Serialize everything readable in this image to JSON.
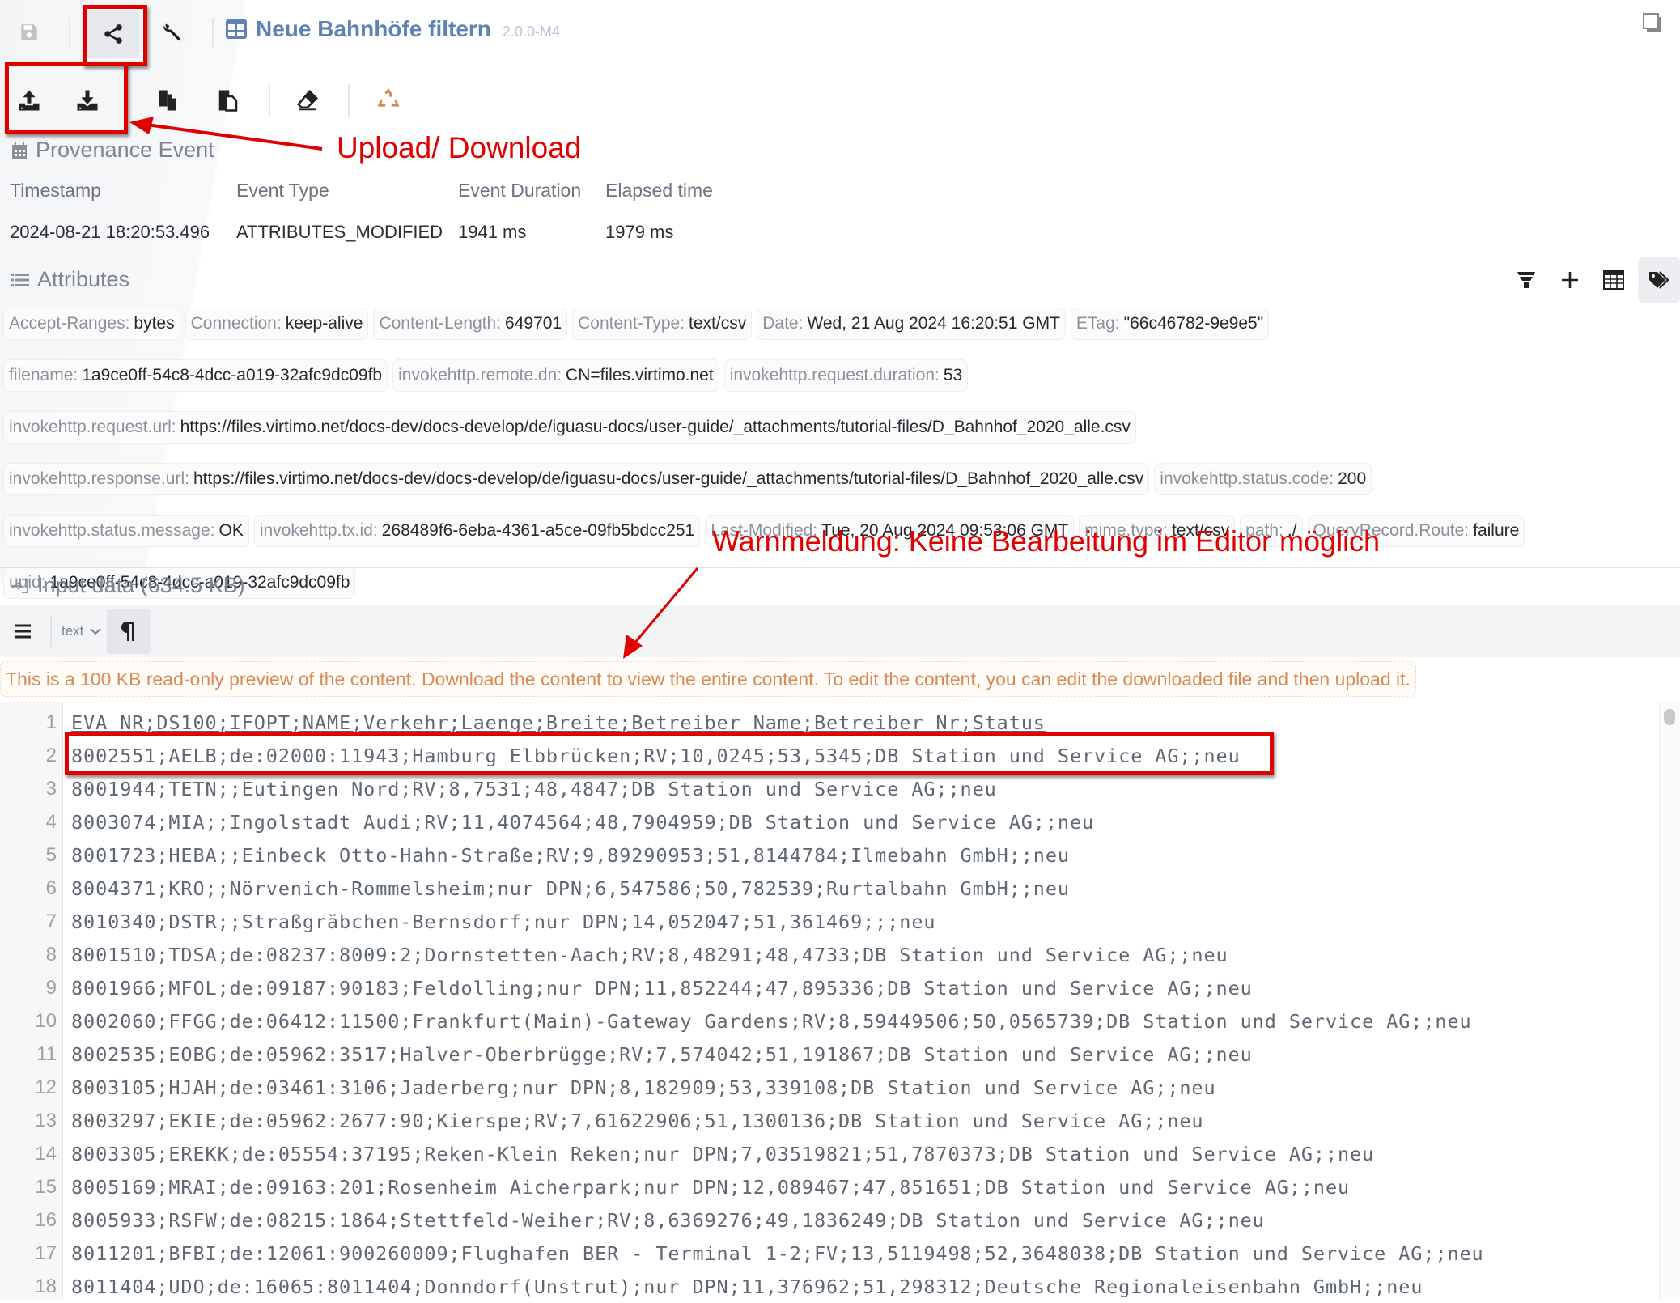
{
  "header": {
    "title": "Neue Bahnhöfe filtern",
    "version": "2.0.0-M4",
    "icons": [
      "save-icon",
      "share-icon",
      "wrench-icon",
      "table-icon",
      "window-icon"
    ]
  },
  "toolbar2": {
    "icons": [
      "upload-icon",
      "download-icon",
      "copy-icon",
      "paste-icon",
      "eraser-icon",
      "recycle-icon"
    ]
  },
  "provenance": {
    "heading": "Provenance Event",
    "columns": [
      {
        "label": "Timestamp",
        "value": "2024-08-21 18:20:53.496"
      },
      {
        "label": "Event Type",
        "value": "ATTRIBUTES_MODIFIED"
      },
      {
        "label": "Event Duration",
        "value": "1941 ms"
      },
      {
        "label": "Elapsed time",
        "value": "1979 ms"
      }
    ]
  },
  "attributes": {
    "heading": "Attributes",
    "actions": [
      "filter-icon",
      "add-icon",
      "table-view-icon",
      "tags-icon"
    ],
    "items": [
      {
        "key": "Accept-Ranges:",
        "value": "bytes"
      },
      {
        "key": "Connection:",
        "value": "keep-alive"
      },
      {
        "key": "Content-Length:",
        "value": "649701"
      },
      {
        "key": "Content-Type:",
        "value": "text/csv"
      },
      {
        "key": "Date:",
        "value": "Wed, 21 Aug 2024 16:20:51 GMT"
      },
      {
        "key": "ETag:",
        "value": "\"66c46782-9e9e5\""
      },
      {
        "key": "filename:",
        "value": "1a9ce0ff-54c8-4dcc-a019-32afc9dc09fb"
      },
      {
        "key": "invokehttp.remote.dn:",
        "value": "CN=files.virtimo.net"
      },
      {
        "key": "invokehttp.request.duration:",
        "value": "53"
      },
      {
        "key": "invokehttp.request.url:",
        "value": "https://files.virtimo.net/docs-dev/docs-develop/de/iguasu-docs/user-guide/_attachments/tutorial-files/D_Bahnhof_2020_alle.csv"
      },
      {
        "key": "invokehttp.response.url:",
        "value": "https://files.virtimo.net/docs-dev/docs-develop/de/iguasu-docs/user-guide/_attachments/tutorial-files/D_Bahnhof_2020_alle.csv"
      },
      {
        "key": "invokehttp.status.code:",
        "value": "200"
      },
      {
        "key": "invokehttp.status.message:",
        "value": "OK"
      },
      {
        "key": "invokehttp.tx.id:",
        "value": "268489f6-6eba-4361-a5ce-09fb5bdcc251"
      },
      {
        "key": "Last-Modified:",
        "value": "Tue, 20 Aug 2024 09:53:06 GMT"
      },
      {
        "key": "mime.type:",
        "value": "text/csv"
      },
      {
        "key": "path:",
        "value": "./"
      },
      {
        "key": "QueryRecord.Route:",
        "value": "failure"
      },
      {
        "key": "uuid:",
        "value": "1a9ce0ff-54c8-4dcc-a019-32afc9dc09fb"
      }
    ]
  },
  "input": {
    "heading": "Input data (634.5 KB)",
    "mode": "text",
    "warning": "This is a 100 KB read-only preview of the content. Download the content to view the entire content. To edit the content, you can edit the downloaded file and then upload it."
  },
  "editor": {
    "lines": [
      "EVA_NR;DS100;IFOPT;NAME;Verkehr;Laenge;Breite;Betreiber_Name;Betreiber_Nr;Status",
      "8002551;AELB;de:02000:11943;Hamburg Elbbrücken;RV;10,0245;53,5345;DB Station und Service AG;;neu",
      "8001944;TETN;;Eutingen Nord;RV;8,7531;48,4847;DB Station und Service AG;;neu",
      "8003074;MIA;;Ingolstadt Audi;RV;11,4074564;48,7904959;DB Station und Service AG;;neu",
      "8001723;HEBA;;Einbeck Otto-Hahn-Straße;RV;9,89290953;51,8144784;Ilmebahn GmbH;;neu",
      "8004371;KRO;;Nörvenich-Rommelsheim;nur DPN;6,547586;50,782539;Rurtalbahn GmbH;;neu",
      "8010340;DSTR;;Straßgräbchen-Bernsdorf;nur DPN;14,052047;51,361469;;;neu",
      "8001510;TDSA;de:08237:8009:2;Dornstetten-Aach;RV;8,48291;48,4733;DB Station und Service AG;;neu",
      "8001966;MFOL;de:09187:90183;Feldolling;nur DPN;11,852244;47,895336;DB Station und Service AG;;neu",
      "8002060;FFGG;de:06412:11500;Frankfurt(Main)-Gateway Gardens;RV;8,59449506;50,0565739;DB Station und Service AG;;neu",
      "8002535;EOBG;de:05962:3517;Halver-Oberbrügge;RV;7,574042;51,191867;DB Station und Service AG;;neu",
      "8003105;HJAH;de:03461:3106;Jaderberg;nur DPN;8,182909;53,339108;DB Station und Service AG;;neu",
      "8003297;EKIE;de:05962:2677:90;Kierspe;RV;7,61622906;51,1300136;DB Station und Service AG;;neu",
      "8003305;EREKK;de:05554:37195;Reken-Klein Reken;nur DPN;7,03519821;51,7870373;DB Station und Service AG;;neu",
      "8005169;MRAI;de:09163:201;Rosenheim Aicherpark;nur DPN;12,089467;47,851651;DB Station und Service AG;;neu",
      "8005933;RSFW;de:08215:1864;Stettfeld-Weiher;RV;8,6369276;49,1836249;DB Station und Service AG;;neu",
      "8011201;BFBI;de:12061:900260009;Flughafen BER - Terminal 1-2;FV;13,5119498;52,3648038;DB Station und Service AG;;neu",
      "8011404;UDO;de:16065:8011404;Donndorf(Unstrut);nur DPN;11,376962;51,298312;Deutsche Regionaleisenbahn GmbH;;neu"
    ]
  },
  "annotations": {
    "upload_download": "Upload/ Download",
    "warning_note": "Warnmeldung: Keine Bearbeitung im Editor möglich",
    "color": "#e00000"
  }
}
